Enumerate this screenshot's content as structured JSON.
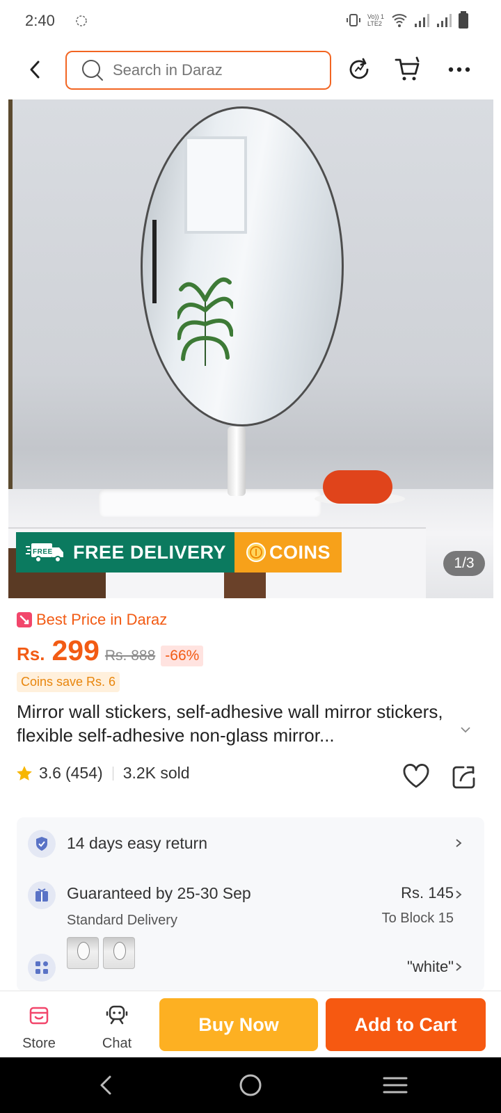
{
  "status_bar": {
    "time": "2:40",
    "network_label": "Vo)) 1 LTE2"
  },
  "header": {
    "search_placeholder": "Search in Daraz"
  },
  "gallery": {
    "badge_free_delivery": "FREE DELIVERY",
    "badge_free_mini": "FREE",
    "badge_coins": "COINS",
    "counter": "1/3"
  },
  "price": {
    "best_price_label": "Best Price in Daraz",
    "currency": "Rs.",
    "current": "299",
    "original": "Rs. 888",
    "discount": "-66%",
    "coins_save": "Coins save Rs. 6"
  },
  "product": {
    "title": "Mirror wall stickers, self-adhesive wall mirror stickers, flexible self-adhesive non-glass mirror...",
    "rating": "3.6",
    "rating_count": "(454)",
    "sold": "3.2K sold"
  },
  "services": {
    "return": "14 days easy return",
    "delivery_title": "Guaranteed by 25-30 Sep",
    "delivery_sub": "Standard Delivery",
    "delivery_price": "Rs. 145",
    "delivery_location": "To Block 15",
    "variant_value": "\"white\""
  },
  "action_bar": {
    "store": "Store",
    "chat": "Chat",
    "buy_now": "Buy Now",
    "add_to_cart": "Add to Cart"
  },
  "colors": {
    "brand_orange": "#f65911",
    "buy_yellow": "#fdb022",
    "free_green": "#0b7a5f"
  }
}
